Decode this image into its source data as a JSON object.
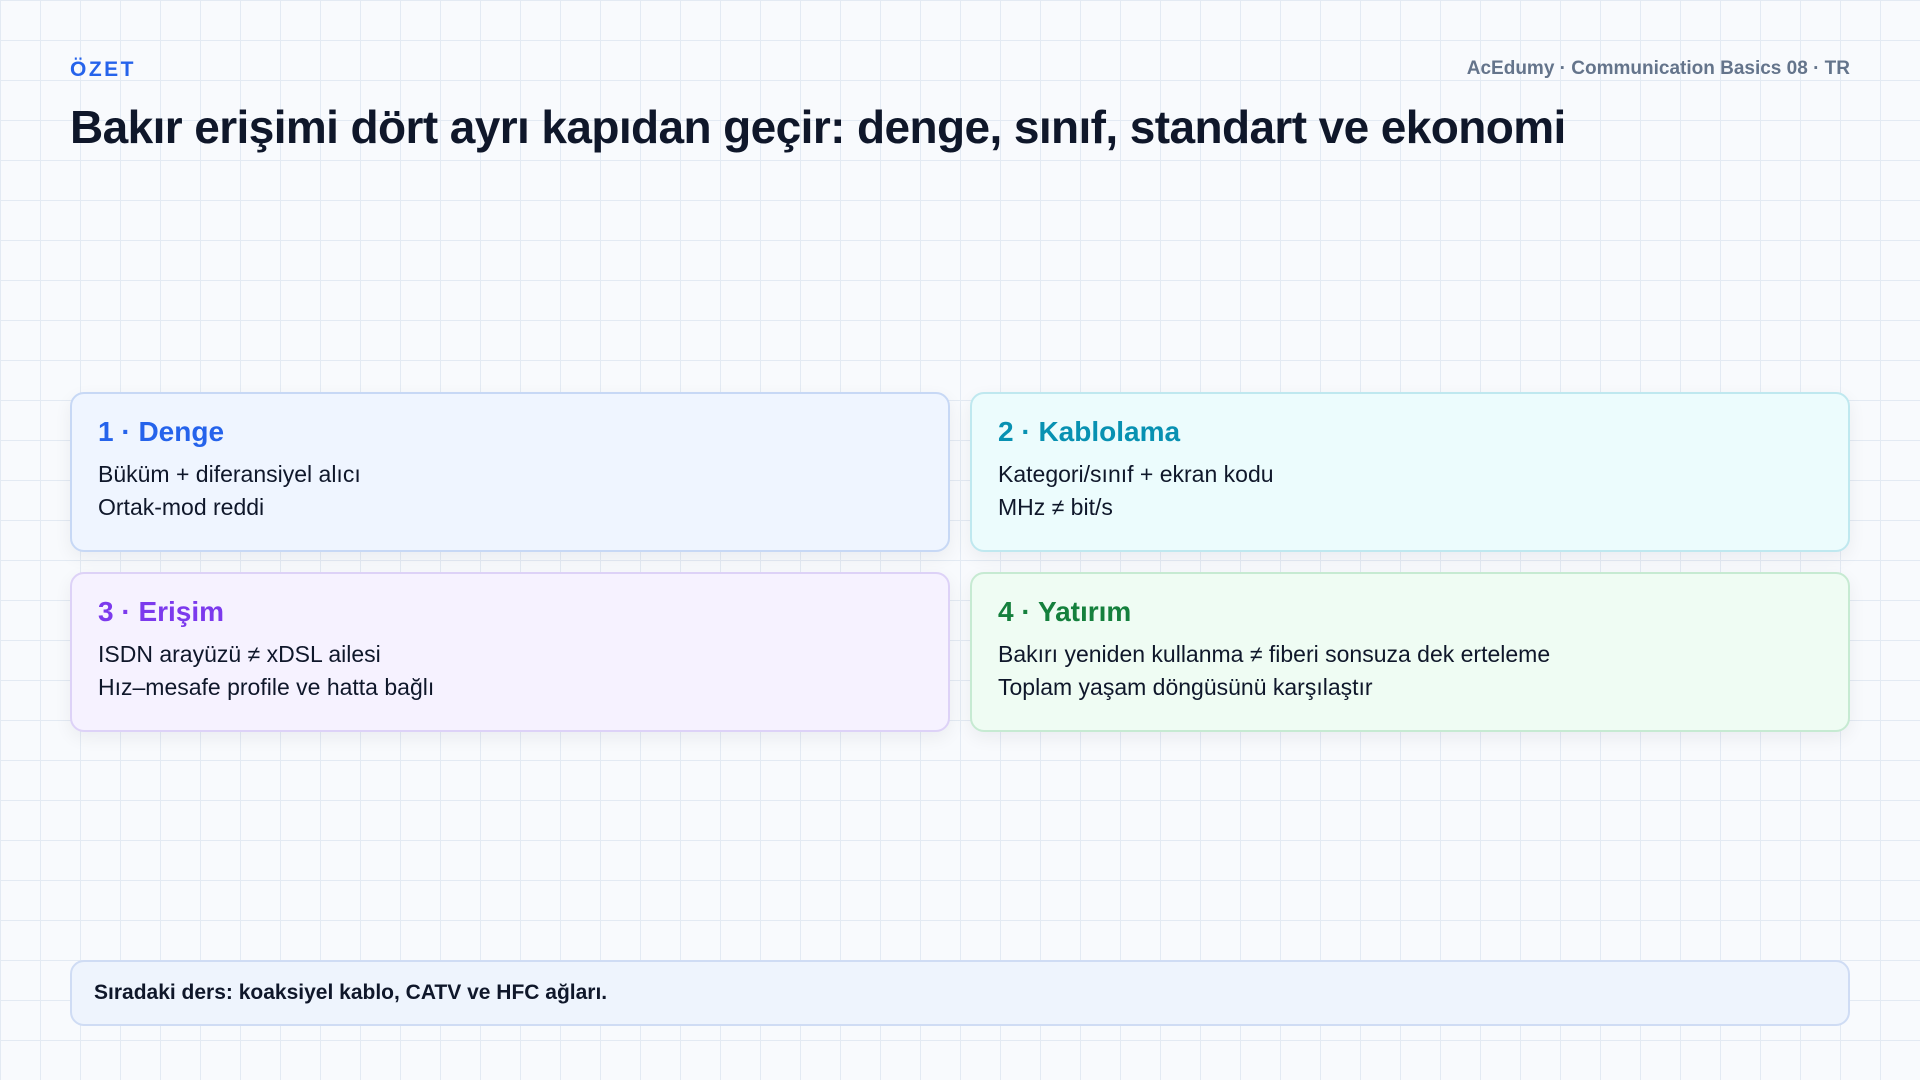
{
  "header": {
    "kicker": "ÖZET",
    "meta": "AcEdumy · Communication Basics 08 · TR",
    "title": "Bakır erişimi dört ayrı kapıdan geçir: denge, sınıf, standart ve ekonomi"
  },
  "cards": [
    {
      "title": "1 · Denge",
      "lines": [
        "Büküm + diferansiyel alıcı",
        "Ortak-mod reddi"
      ],
      "accent": "#2563eb",
      "bg": "#eff5ff",
      "border": "#c7d8f5"
    },
    {
      "title": "2 · Kablolama",
      "lines": [
        "Kategori/sınıf + ekran kodu",
        "MHz ≠ bit/s"
      ],
      "accent": "#0891b2",
      "bg": "#ecfcfd",
      "border": "#bfe8ef"
    },
    {
      "title": "3 · Erişim",
      "lines": [
        "ISDN arayüzü ≠ xDSL ailesi",
        "Hız–mesafe profile ve hatta bağlı"
      ],
      "accent": "#7c3aed",
      "bg": "#f6f2ff",
      "border": "#ddd2f7"
    },
    {
      "title": "4 · Yatırım",
      "lines": [
        "Bakırı yeniden kullanma ≠ fiberi sonsuza dek erteleme",
        "Toplam yaşam döngüsünü karşılaştır"
      ],
      "accent": "#15803d",
      "bg": "#effcf3",
      "border": "#c6ead2"
    }
  ],
  "footer": {
    "text": "Sıradaki ders: koaksiyel kablo, CATV ve HFC ağları."
  }
}
